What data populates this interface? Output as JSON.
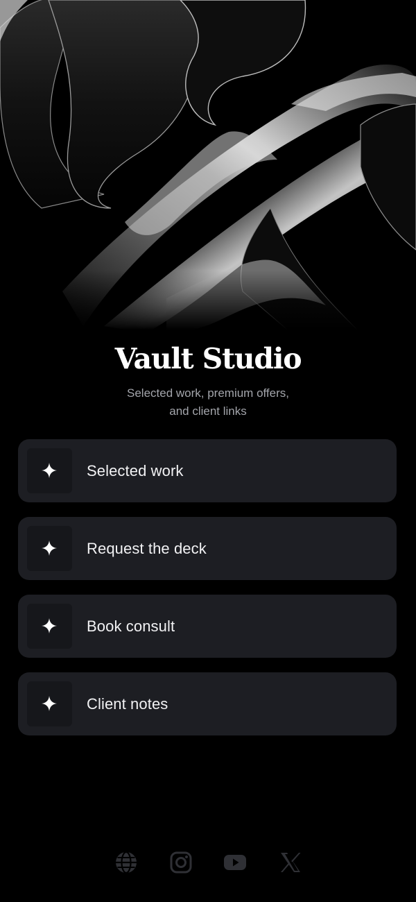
{
  "profile": {
    "name": "Vault Studio",
    "bio": "Selected work, premium offers, and client links"
  },
  "links": [
    {
      "label": "Selected work",
      "icon": "sparkle-icon"
    },
    {
      "label": "Request the deck",
      "icon": "sparkle-icon"
    },
    {
      "label": "Book consult",
      "icon": "sparkle-icon"
    },
    {
      "label": "Client notes",
      "icon": "sparkle-icon"
    }
  ],
  "socials": [
    {
      "icon": "globe-icon"
    },
    {
      "icon": "instagram-icon"
    },
    {
      "icon": "youtube-icon"
    },
    {
      "icon": "x-icon"
    }
  ],
  "colors": {
    "background": "#000000",
    "card": "#1d1e23",
    "card_icon_box": "#16171b",
    "text": "#f2f2f4",
    "subtitle": "#a3a5ab",
    "social_icon": "#2f3035"
  }
}
